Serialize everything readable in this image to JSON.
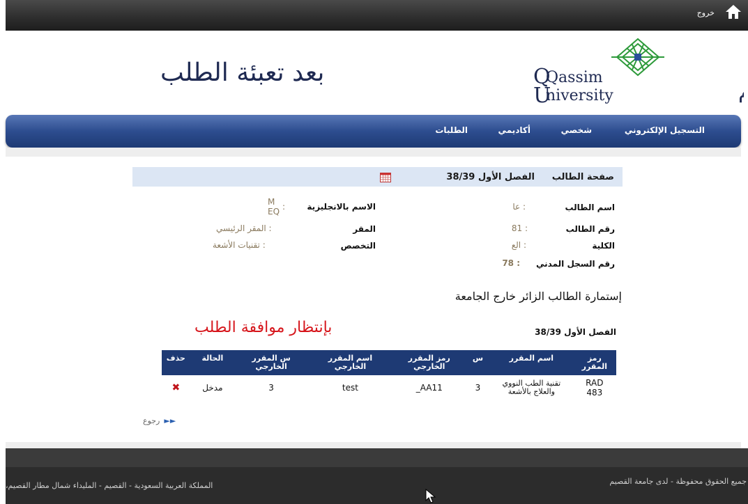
{
  "topbar": {
    "logout_label": "خروج"
  },
  "header": {
    "page_heading": "بعد تعبئة الطلب",
    "logo_text_line1": "Qassim",
    "logo_text_line2": "University",
    "logo_arabic": "جامعة القصيم"
  },
  "nav": {
    "items": [
      {
        "label": "التسجيل الإلكتروني"
      },
      {
        "label": "شخصي"
      },
      {
        "label": "أكاديمي"
      },
      {
        "label": "الطلبات"
      }
    ]
  },
  "student": {
    "page_title": "صفحة الطالب",
    "semester": "الفصل الأول 38/39",
    "name_label": "اسم الطالب",
    "name_value": ": عا",
    "id_label": "رقم الطالب",
    "id_value": ": 81",
    "college_label": "الكلية",
    "college_value": ": الع",
    "civil_id_label": "رقم السجل المدني",
    "civil_id_value": ": 78",
    "english_name_label": "الاسم بالانجليزية",
    "english_name_value_1": "M",
    "english_name_value_2": "EQ",
    "english_name_colon": ":",
    "campus_label": "المقر",
    "campus_value": ": المقر الرئيسي",
    "major_label": "التخصص",
    "major_value": ": تقنيات الأشعة"
  },
  "form": {
    "title": "إستمارة الطالب الزائر خارج الجامعة",
    "semester": "الفصل الأول 38/39",
    "status_heading": "بإنتظار موافقة الطلب"
  },
  "table": {
    "headers": [
      "رمز المقرر",
      "اسم المقرر",
      "س",
      "رمز المقرر الخارجي",
      "اسم المقرر الخارجي",
      "س المقرر الخارجي",
      "الحالة",
      "حذف"
    ],
    "rows": [
      {
        "code": "RAD 483",
        "name": "تقنية الطب النووي والعلاج بالأشعة",
        "hours": "3",
        "ext_code": "AA11_",
        "ext_name": "test",
        "ext_hours": "3",
        "status": "مدخل",
        "delete_icon": "✖"
      }
    ]
  },
  "back_label": "رجوع",
  "footer": {
    "rights": "جميع الحقوق محفوظة - لدى جامعة القصيم",
    "address": "المملكة العربية السعودية - القصيم - المليداء شمال مطار القصيم،"
  }
}
